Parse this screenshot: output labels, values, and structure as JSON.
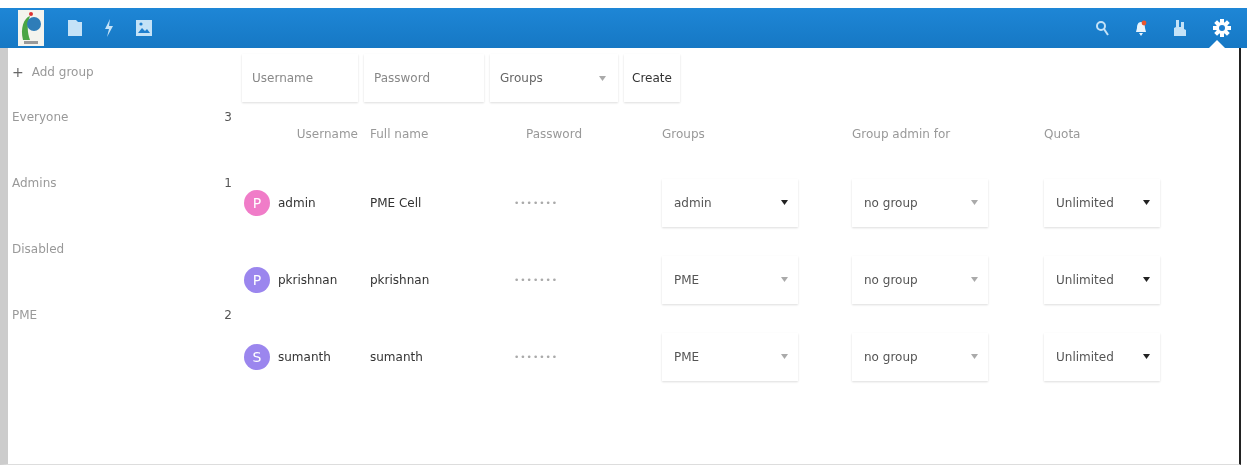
{
  "sidebar": {
    "add_label": "+",
    "add_text": "Add group",
    "items": [
      {
        "name": "Everyone",
        "count": "3"
      },
      {
        "name": "Admins",
        "count": "1"
      },
      {
        "name": "Disabled"
      },
      {
        "name": "PME",
        "count": "2"
      }
    ]
  },
  "new_user": {
    "username_placeholder": "Username",
    "password_placeholder": "Password",
    "groups_placeholder": "Groups",
    "create_button": "Create"
  },
  "table": {
    "columns": [
      "Username",
      "Full name",
      "Password",
      "Groups",
      "Group admin for",
      "Quota"
    ],
    "rows": [
      {
        "initial": "P",
        "color": "#f07cc8",
        "username": "admin",
        "full_name": "PME Cell",
        "password": "•••••••",
        "groups": "admin",
        "group_admin": "no group",
        "quota": "Unlimited"
      },
      {
        "initial": "P",
        "color": "#9b86ee",
        "username": "pkrishnan",
        "full_name": "pkrishnan",
        "password": "•••••••",
        "groups": "PME",
        "group_admin": "no group",
        "quota": "Unlimited"
      },
      {
        "initial": "S",
        "color": "#9b86ee",
        "username": "sumanth",
        "full_name": "sumanth",
        "password": "•••••••",
        "groups": "PME",
        "group_admin": "no group",
        "quota": "Unlimited"
      }
    ]
  }
}
